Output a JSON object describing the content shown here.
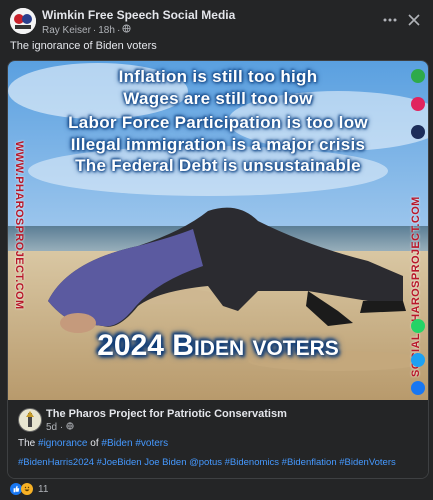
{
  "post": {
    "group_name": "Wimkin Free Speech Social Media",
    "author": "Ray Keiser",
    "time": "18h",
    "separator": "·",
    "caption": "The ignorance of  Biden voters"
  },
  "image": {
    "lines": [
      "Inflation is still too high",
      "Wages are still too low",
      "Labor Force Participation is too low",
      "Illegal immigration is a major crisis",
      "The Federal Debt is unsustainable"
    ],
    "bottom": "2024 Biden voters",
    "left_vertical": "WWW.PHAROSPROJECT.COM",
    "right_vertical": "SOCIAL.PHAROSPROJECT.COM"
  },
  "shared": {
    "page_name": "The Pharos Project for Patriotic Conservatism",
    "time": "5d",
    "text_prefix": "The ",
    "text_tag1": "#ignorance",
    "text_mid": " of ",
    "text_tag2": "#Biden",
    "text_sp": " ",
    "text_tag3": "#voters",
    "hashtags": "#BidenHarris2024 #JoeBiden Joe Biden @potus  #Bidenomics #Bidenflation #BidenVoters"
  },
  "reactions": {
    "count": "11"
  },
  "colors": {
    "background": "#242526",
    "link": "#4599ff",
    "muted": "#b0b3b8"
  }
}
